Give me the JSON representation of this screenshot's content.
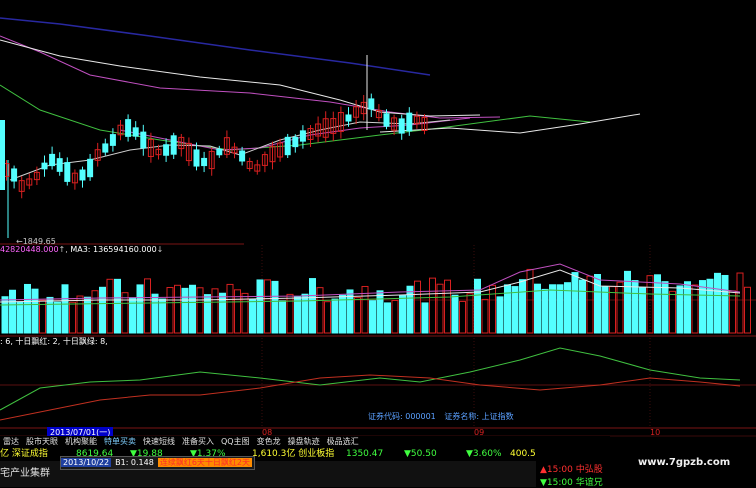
{
  "colors": {
    "up": "#d82020",
    "down": "#54ffff",
    "ma_white": "#e8e8e8",
    "ma_magenta": "#c050c0",
    "ma_green": "#40c040",
    "ma_blue": "#2828a0",
    "text_green": "#40ff40",
    "text_yellow": "#ffff33",
    "text_red": "#ff3030"
  },
  "price_chart": {
    "low_label": "1849.65"
  },
  "volume_chart": {
    "info_a": "42820448.000",
    "info_b": "MA3: 136594160.000"
  },
  "indicator": {
    "info": "6, 十日飘红: 2, 十日飘绿: 8,"
  },
  "code_info": {
    "code_label": "证券代码: 000001",
    "name_label": "证券名称: 上证指数"
  },
  "time_axis": {
    "date_box": "2013/07/01(一)",
    "months": [
      "08",
      "09",
      "10"
    ]
  },
  "tabs": [
    {
      "label": "雷达",
      "active": false
    },
    {
      "label": "股市天眼",
      "active": false
    },
    {
      "label": "机构聚能",
      "active": false
    },
    {
      "label": "特单买卖",
      "active": true
    },
    {
      "label": "快速短线",
      "active": false
    },
    {
      "label": "准备买入",
      "active": false
    },
    {
      "label": "QQ主图",
      "active": false
    },
    {
      "label": "变色龙",
      "active": false
    },
    {
      "label": "操盘轨迹",
      "active": false
    },
    {
      "label": "极品选汇",
      "active": false
    }
  ],
  "quote": {
    "prefix": "亿 深证成指",
    "value1": "8619.64",
    "change1": "▼19.88",
    "pct1": "▼1.37%",
    "amount": "1,610.3亿 创业板指",
    "value2": "1350.47",
    "change2": "▼50.50",
    "pct2": "▼3.60%",
    "amount2": "400.5亿"
  },
  "bottom_row": {
    "stock_name": "宅产业集群",
    "alert_date": "2013/10/22",
    "alert_b1": "B1: 0.148",
    "alert_signal": "连续飘红6天十日飘红2天"
  },
  "right_panel": {
    "line1": "▲15:00 中弘股",
    "line2": "▼15:00 华谊兄"
  },
  "watermark": "www.7gpzb.com"
}
